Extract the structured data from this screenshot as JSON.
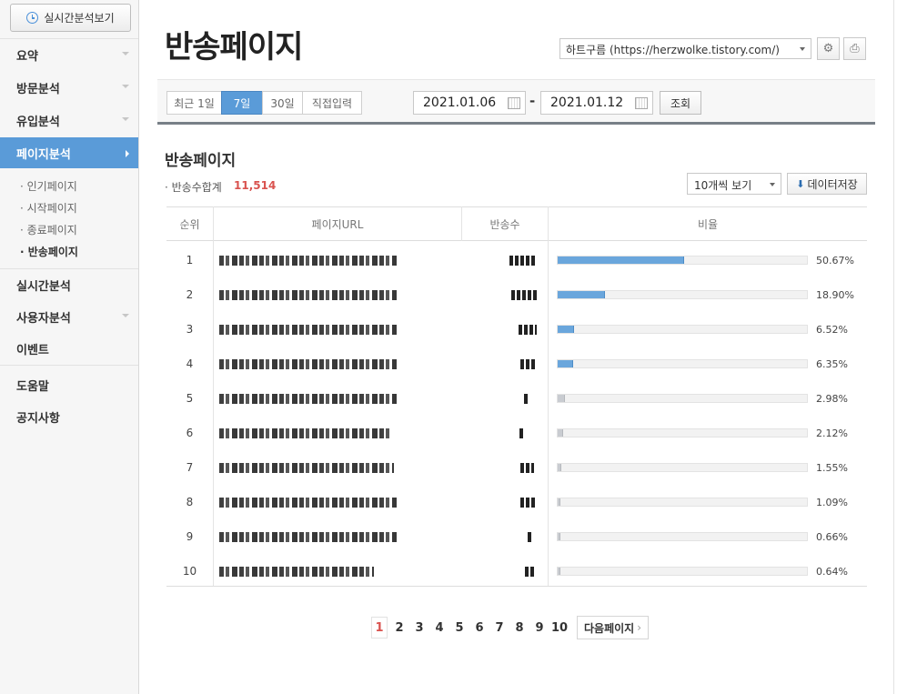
{
  "sidebar": {
    "realtime_button": "실시간분석보기",
    "menu": [
      "요약",
      "방문분석",
      "유입분석",
      "페이지분석",
      "실시간분석",
      "사용자분석",
      "이벤트",
      "도움말",
      "공지사항"
    ],
    "submenu": [
      "· 인기페이지",
      "· 시작페이지",
      "· 종료페이지",
      "· 반송페이지"
    ]
  },
  "header": {
    "title": "반송페이지",
    "blog_select": "하트구름 (https://herzwolke.tistory.com/)"
  },
  "filters": {
    "ranges": [
      "최근 1일",
      "7일",
      "30일",
      "직접입력"
    ],
    "selected_range": "7일",
    "date_from": "2021.01.06",
    "date_sep": "-",
    "date_to": "2021.01.12",
    "search_label": "조회"
  },
  "section": {
    "title": "반송페이지",
    "sum_label": "· 반송수합계",
    "sum_value": "11,514",
    "perpage": "10개씩 보기",
    "save_label": "데이터저장"
  },
  "table": {
    "headers": [
      "순위",
      "페이지URL",
      "반송수",
      "비율"
    ],
    "rows": [
      {
        "rank": "1",
        "ratio": 50.67,
        "pct": "50.67%"
      },
      {
        "rank": "2",
        "ratio": 18.9,
        "pct": "18.90%"
      },
      {
        "rank": "3",
        "ratio": 6.52,
        "pct": "6.52%"
      },
      {
        "rank": "4",
        "ratio": 6.35,
        "pct": "6.35%"
      },
      {
        "rank": "5",
        "ratio": 2.98,
        "pct": "2.98%"
      },
      {
        "rank": "6",
        "ratio": 2.12,
        "pct": "2.12%"
      },
      {
        "rank": "7",
        "ratio": 1.55,
        "pct": "1.55%"
      },
      {
        "rank": "8",
        "ratio": 1.09,
        "pct": "1.09%"
      },
      {
        "rank": "9",
        "ratio": 0.66,
        "pct": "0.66%"
      },
      {
        "rank": "10",
        "ratio": 0.64,
        "pct": "0.64%"
      }
    ]
  },
  "pagination": {
    "pages": [
      "1",
      "2",
      "3",
      "4",
      "5",
      "6",
      "7",
      "8",
      "9",
      "10"
    ],
    "current": "1",
    "next_label": "다음페이지"
  },
  "colors": {
    "accent": "#5a9bd8",
    "bar": "#6aa6dc",
    "highlight": "#d9534f"
  }
}
